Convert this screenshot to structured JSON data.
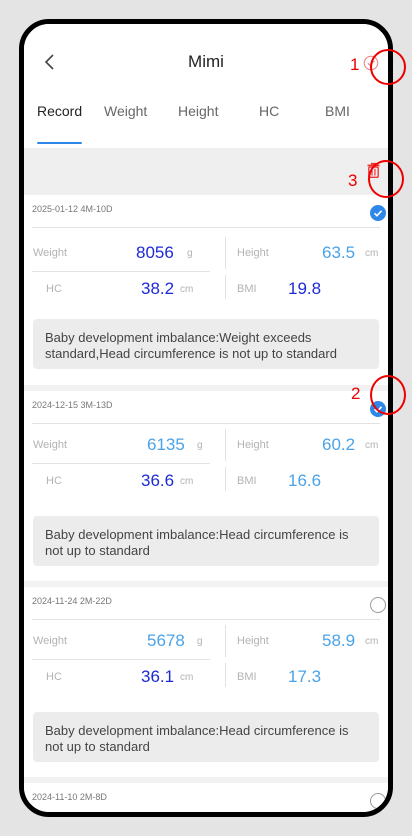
{
  "header": {
    "title": "Mimi"
  },
  "tabs": [
    {
      "label": "Record"
    },
    {
      "label": "Weight"
    },
    {
      "label": "Height"
    },
    {
      "label": "HC"
    },
    {
      "label": "BMI"
    }
  ],
  "annotations": [
    "1",
    "2",
    "3"
  ],
  "colors": {
    "accent": "#2f88e8",
    "value_dark": "#1d2ad6",
    "value_light": "#4aa3e8",
    "annotation": "#e00000"
  },
  "icons": {
    "back": "chevron-left-icon",
    "select": "check-circle-icon",
    "delete": "trash-icon"
  },
  "records": [
    {
      "date": "2025-01-12  4M-10D",
      "selected": true,
      "weight_label": "Weight",
      "weight_value": "8056",
      "weight_unit": "g",
      "height_label": "Height",
      "height_value": "63.5",
      "height_unit": "cm",
      "hc_label": "HC",
      "hc_value": "38.2",
      "hc_unit": "cm",
      "bmi_label": "BMI",
      "bmi_value": "19.8",
      "message": "Baby development imbalance:Weight exceeds standard,Head circumference is not up to standard"
    },
    {
      "date": "2024-12-15  3M-13D",
      "selected": true,
      "weight_label": "Weight",
      "weight_value": "6135",
      "weight_unit": "g",
      "height_label": "Height",
      "height_value": "60.2",
      "height_unit": "cm",
      "hc_label": "HC",
      "hc_value": "36.6",
      "hc_unit": "cm",
      "bmi_label": "BMI",
      "bmi_value": "16.6",
      "message": "Baby development imbalance:Head circumference is not up to standard"
    },
    {
      "date": "2024-11-24  2M-22D",
      "selected": false,
      "weight_label": "Weight",
      "weight_value": "5678",
      "weight_unit": "g",
      "height_label": "Height",
      "height_value": "58.9",
      "height_unit": "cm",
      "hc_label": "HC",
      "hc_value": "36.1",
      "hc_unit": "cm",
      "bmi_label": "BMI",
      "bmi_value": "17.3",
      "message": "Baby development imbalance:Head circumference is not up to standard"
    },
    {
      "date": "2024-11-10  2M-8D",
      "selected": false
    }
  ]
}
